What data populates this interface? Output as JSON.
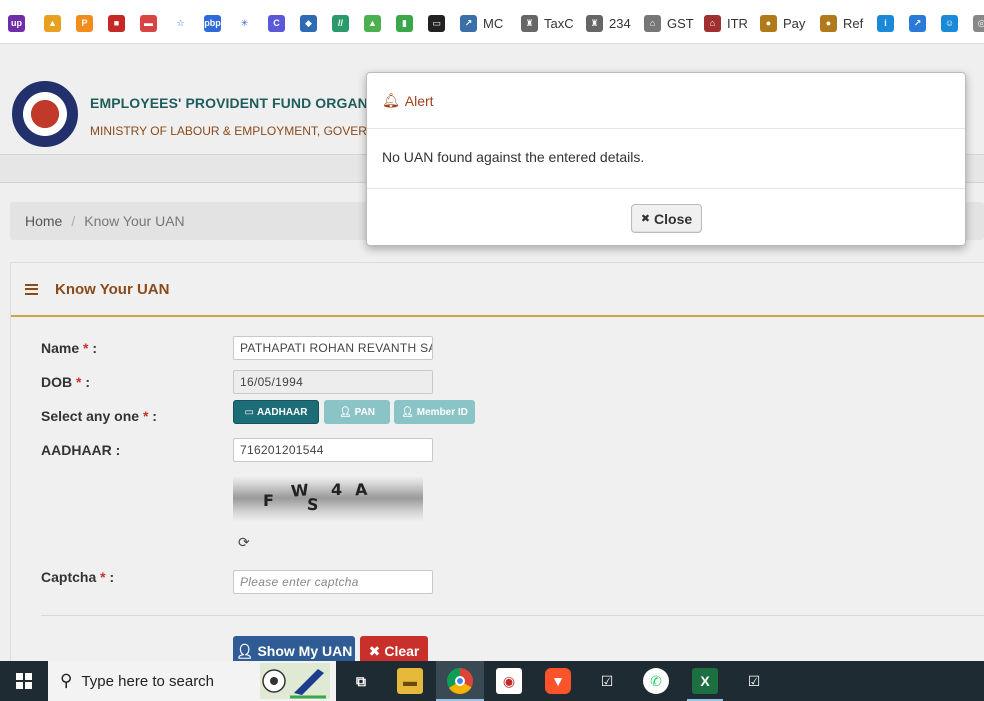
{
  "bookmarks": [
    {
      "label": "",
      "icon": "upwork-icon",
      "color": "#6f2da8",
      "glyph": "up"
    },
    {
      "label": "",
      "icon": "triangle-logo-icon",
      "color": "#e8a020",
      "glyph": "▲"
    },
    {
      "label": "",
      "icon": "p-logo-icon",
      "color": "#f28c1a",
      "glyph": "P"
    },
    {
      "label": "",
      "icon": "red-square-icon",
      "color": "#c62828",
      "glyph": "■"
    },
    {
      "label": "",
      "icon": "red-box-icon",
      "color": "#d84343",
      "glyph": "▬"
    },
    {
      "label": "",
      "icon": "star-outline-icon",
      "color": "#ffffff",
      "glyph": "☆"
    },
    {
      "label": "",
      "icon": "pbp-icon",
      "color": "#2f6bd8",
      "glyph": "pbp"
    },
    {
      "label": "",
      "icon": "sparkle-icon",
      "color": "#ffffff",
      "glyph": "✳"
    },
    {
      "label": "",
      "icon": "c-logo-icon",
      "color": "#5a5ad8",
      "glyph": "C"
    },
    {
      "label": "",
      "icon": "shield-logo-icon",
      "color": "#2d6bb3",
      "glyph": "◆"
    },
    {
      "label": "",
      "icon": "slash-logo-icon",
      "color": "#2a9a6a",
      "glyph": "//"
    },
    {
      "label": "",
      "icon": "triangle-green-icon",
      "color": "#4caf50",
      "glyph": "▲"
    },
    {
      "label": "",
      "icon": "bar-chart-icon",
      "color": "#3aa84a",
      "glyph": "▮"
    },
    {
      "label": "",
      "icon": "card-icon",
      "color": "#222222",
      "glyph": "▭"
    },
    {
      "label": "MC",
      "icon": "mc-chart-icon",
      "color": "#3a6fa8",
      "glyph": "↗"
    },
    {
      "label": "TaxC",
      "icon": "emblem-icon",
      "color": "#666666",
      "glyph": "♜"
    },
    {
      "label": "234",
      "icon": "emblem-icon",
      "color": "#666666",
      "glyph": "♜"
    },
    {
      "label": "GST",
      "icon": "building-icon",
      "color": "#777777",
      "glyph": "⌂"
    },
    {
      "label": "ITR",
      "icon": "itr-logo-icon",
      "color": "#a03030",
      "glyph": "⌂"
    },
    {
      "label": "Pay",
      "icon": "pay-logo-icon",
      "color": "#b07a1a",
      "glyph": "●"
    },
    {
      "label": "Ref",
      "icon": "ref-logo-icon",
      "color": "#b07a1a",
      "glyph": "●"
    },
    {
      "label": "",
      "icon": "info-circle-icon",
      "color": "#1a8ad8",
      "glyph": "i"
    },
    {
      "label": "",
      "icon": "chart-line-icon",
      "color": "#2a7ad8",
      "glyph": "↗"
    },
    {
      "label": "",
      "icon": "robot-icon",
      "color": "#1a8ad8",
      "glyph": "☺"
    },
    {
      "label": "",
      "icon": "openai-icon",
      "color": "#888888",
      "glyph": "◎"
    }
  ],
  "site": {
    "org_name": "EMPLOYEES' PROVIDENT FUND ORGANISA",
    "org_sub": "MINISTRY OF LABOUR & EMPLOYMENT, GOVERNM"
  },
  "breadcrumb": {
    "home": "Home",
    "separator": "/",
    "current": "Know Your UAN"
  },
  "panel": {
    "title": "Know Your UAN"
  },
  "form": {
    "name_label": "Name",
    "dob_label": "DOB",
    "select_label": "Select any one",
    "aadhaar_label": "AADHAAR :",
    "captcha_label": "Captcha",
    "required_mark": "*",
    "colon": ":",
    "name_value": "PATHAPATI ROHAN REVANTH SA",
    "dob_value": "16/05/1994",
    "aadhaar_value": "716201201544",
    "captcha_placeholder": "Please enter captcha",
    "options": {
      "aadhaar": "AADHAAR",
      "pan": "PAN",
      "member_id": "Member ID",
      "selected": "AADHAAR"
    },
    "captcha_chars": [
      "F",
      "W",
      "S",
      "4",
      "A"
    ],
    "show_button": "Show My UAN",
    "clear_button": "Clear"
  },
  "modal": {
    "title": "Alert",
    "message": "No UAN found against the entered details.",
    "close_label": "Close"
  },
  "taskbar": {
    "search_text": "Type here to search",
    "apps": [
      "task-view",
      "file-explorer",
      "chrome",
      "epfo-app",
      "brave",
      "todo",
      "whatsapp",
      "excel",
      "todo"
    ]
  },
  "colors": {
    "brand_teal": "#1f5c5c",
    "brand_brown": "#8a4b1b",
    "primary_button": "#2f5c95",
    "danger_button": "#c9302c",
    "selected_option": "#1c6d78",
    "unselected_option": "#8ac4c7"
  }
}
